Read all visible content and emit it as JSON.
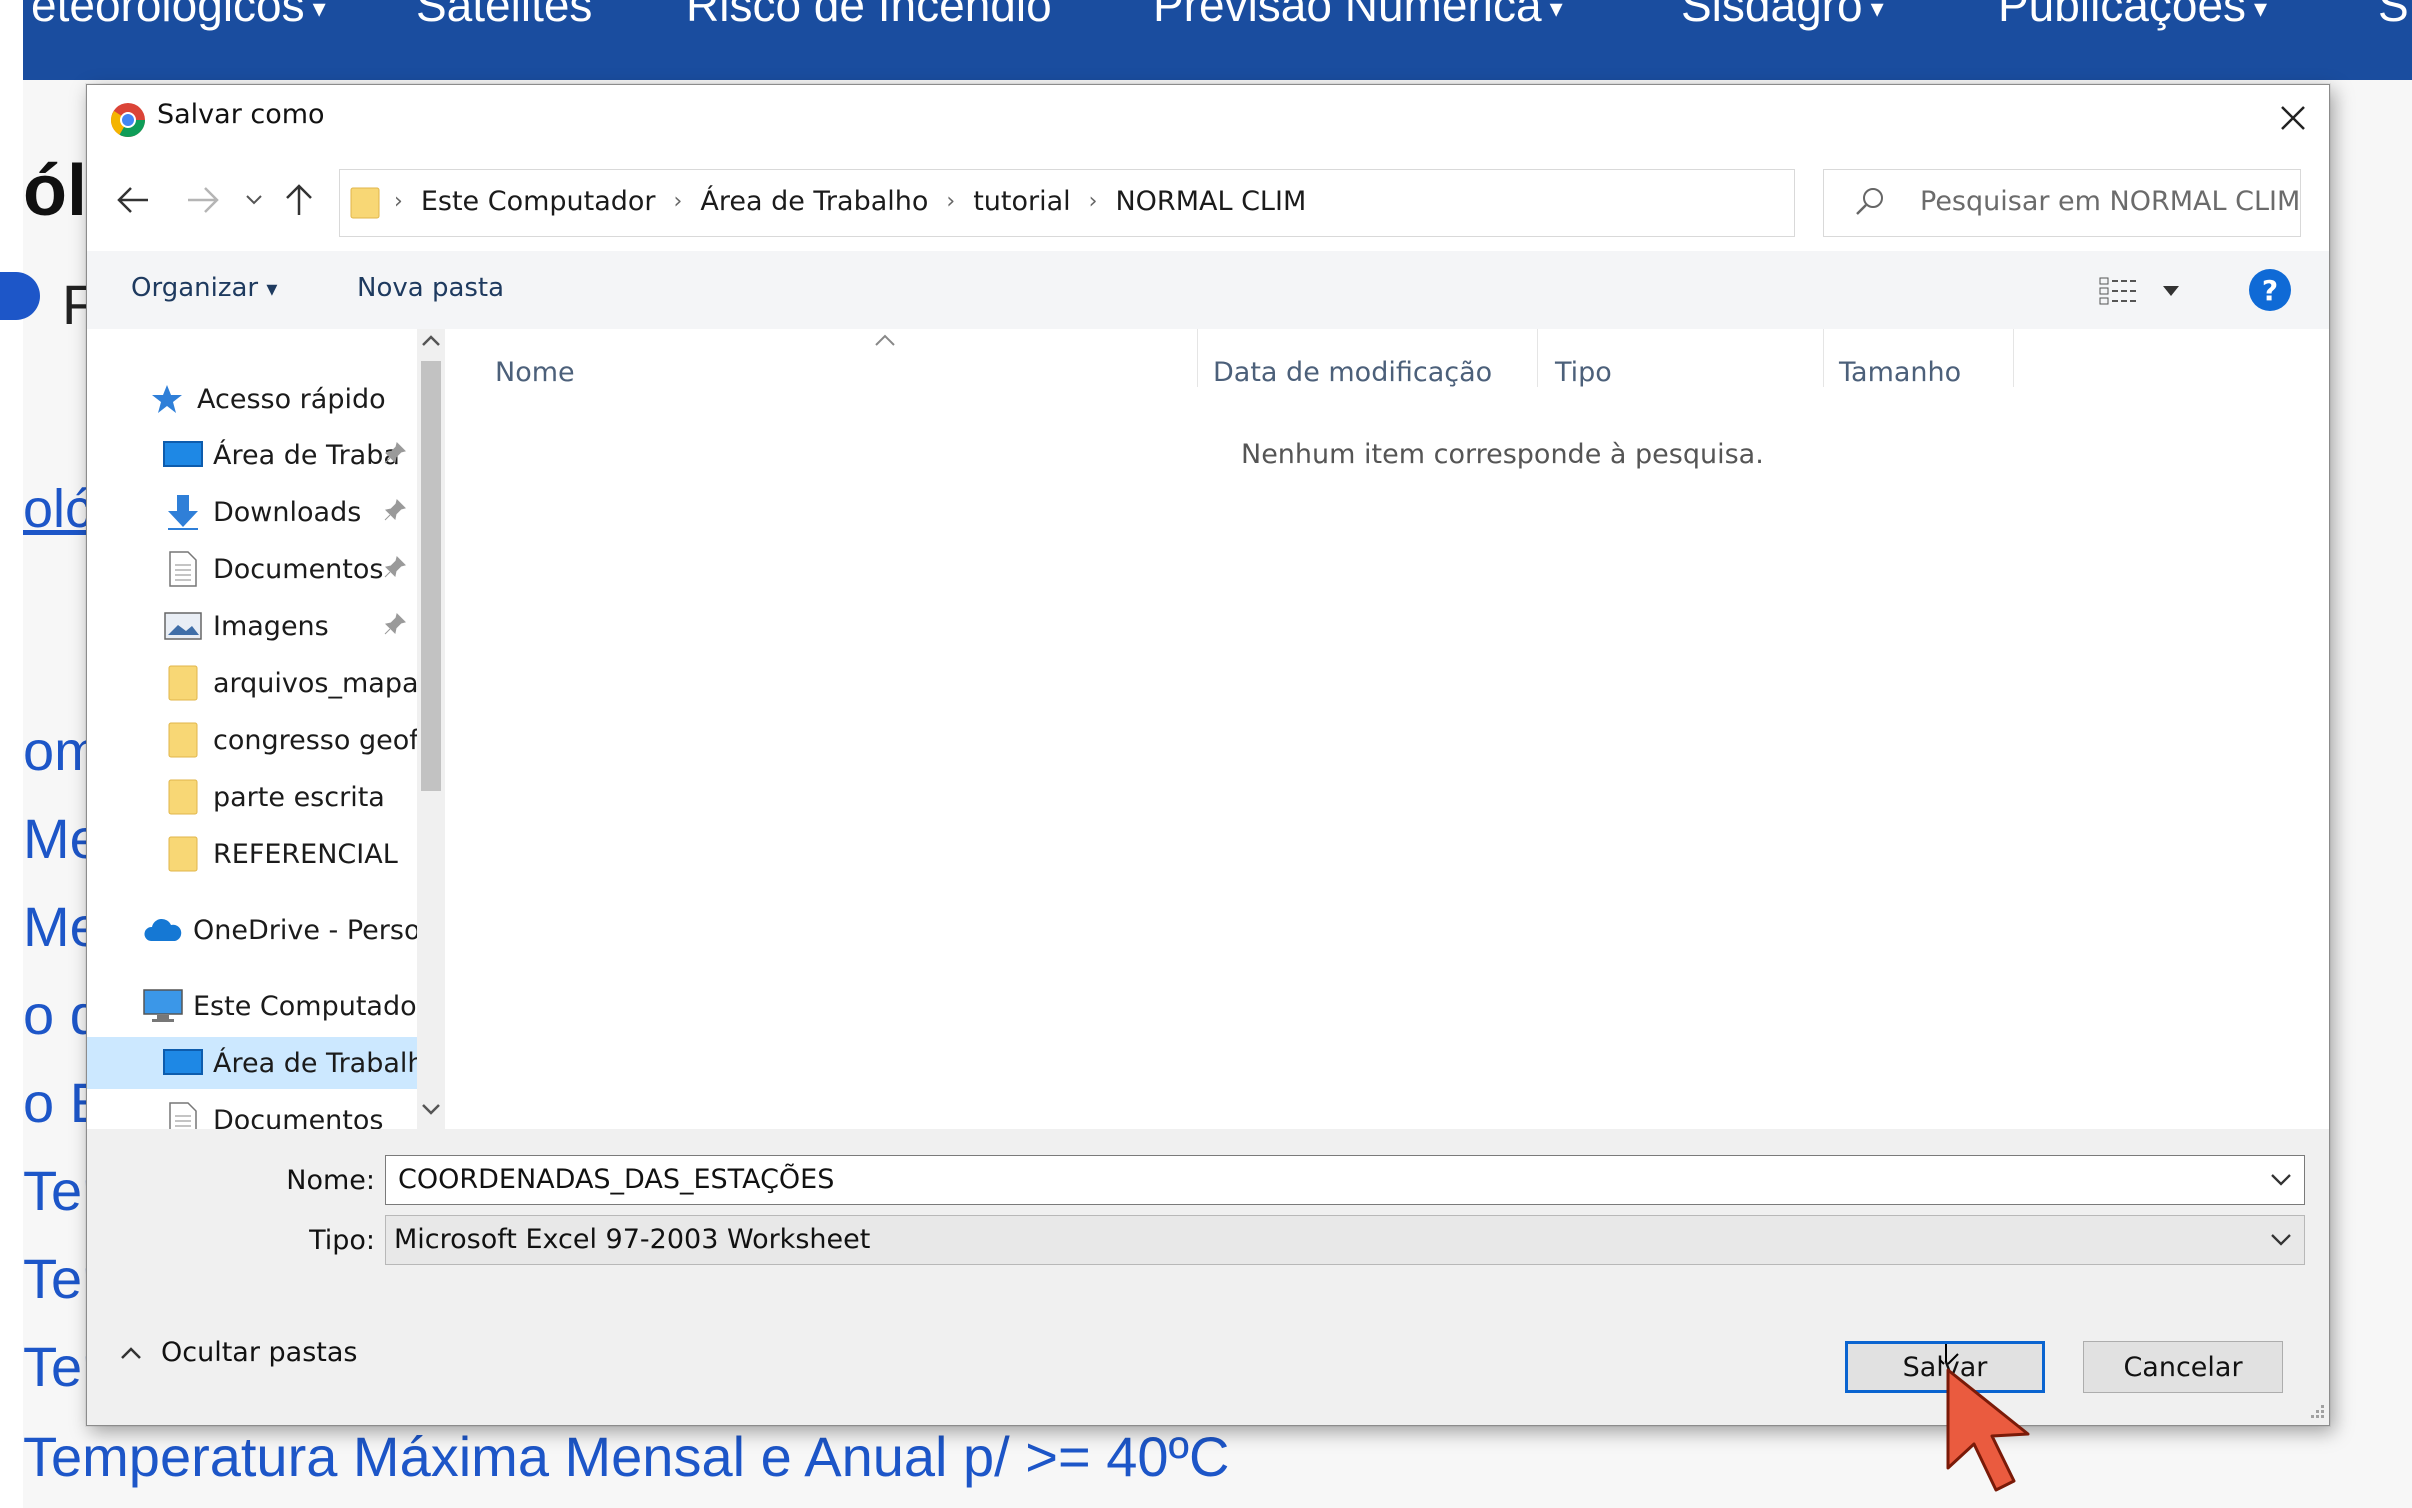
{
  "background_page": {
    "nav_items": [
      {
        "label": "eteorológicos",
        "caret": "▾"
      },
      {
        "label": "Satélites",
        "caret": ""
      },
      {
        "label": "Risco de Incêndio",
        "caret": ""
      },
      {
        "label": "Previsão Numérica",
        "caret": "▾"
      },
      {
        "label": "Sisdagro",
        "caret": "▾"
      },
      {
        "label": "Publicações",
        "caret": "▾"
      },
      {
        "label": "S",
        "caret": ""
      }
    ],
    "side_fragments": [
      "ól",
      "F",
      "olć",
      "om",
      "Me",
      "Me",
      "o d",
      "o E",
      "Ter",
      "Ter",
      "Ter"
    ],
    "bottom_link": "Temperatura Máxima Mensal e Anual p/ >= 40ºC",
    "colors": {
      "nav": "#1a4d9f",
      "link": "#1d56c8"
    }
  },
  "dialog": {
    "title": "Salvar como",
    "breadcrumb": [
      "Este Computador",
      "Área de Trabalho",
      "tutorial",
      "NORMAL CLIM"
    ],
    "search_placeholder": "Pesquisar em NORMAL CLIM",
    "toolbar": {
      "organize": "Organizar",
      "organize_caret": "▾",
      "new_folder": "Nova pasta",
      "help": "?"
    },
    "nav_items": [
      {
        "label": "Acesso rápido",
        "icon": "star-icon",
        "pinned": false
      },
      {
        "label": "Área de Traba",
        "icon": "desktop-icon",
        "pinned": true
      },
      {
        "label": "Downloads",
        "icon": "download-icon",
        "pinned": true
      },
      {
        "label": "Documentos",
        "icon": "document-icon",
        "pinned": true
      },
      {
        "label": "Imagens",
        "icon": "image-icon",
        "pinned": true
      },
      {
        "label": "arquivos_mapas",
        "icon": "folder-icon",
        "pinned": false
      },
      {
        "label": "congresso geofr",
        "icon": "folder-icon",
        "pinned": false
      },
      {
        "label": "parte escrita",
        "icon": "folder-icon",
        "pinned": false
      },
      {
        "label": "REFERENCIAL",
        "icon": "folder-icon",
        "pinned": false
      },
      {
        "label": "OneDrive - Persor",
        "icon": "cloud-icon",
        "pinned": false
      },
      {
        "label": "Este Computador",
        "icon": "computer-icon",
        "pinned": false
      },
      {
        "label": "Área de Trabalho",
        "icon": "desktop-icon",
        "pinned": false,
        "selected": true
      },
      {
        "label": "Documentos",
        "icon": "document-icon",
        "pinned": false
      }
    ],
    "columns": [
      "Nome",
      "Data de modificação",
      "Tipo",
      "Tamanho"
    ],
    "empty_message": "Nenhum item corresponde à pesquisa.",
    "file_name_label": "Nome:",
    "file_name_value": "COORDENADAS_DAS_ESTAÇÕES",
    "file_type_label": "Tipo:",
    "file_type_value": "Microsoft Excel 97-2003 Worksheet",
    "hide_folders": "Ocultar pastas",
    "save_button": "Salvar",
    "cancel_button": "Cancelar",
    "colors": {
      "accent": "#0a64d0",
      "selected": "#cce8ff",
      "folder": "#f8d775"
    }
  }
}
